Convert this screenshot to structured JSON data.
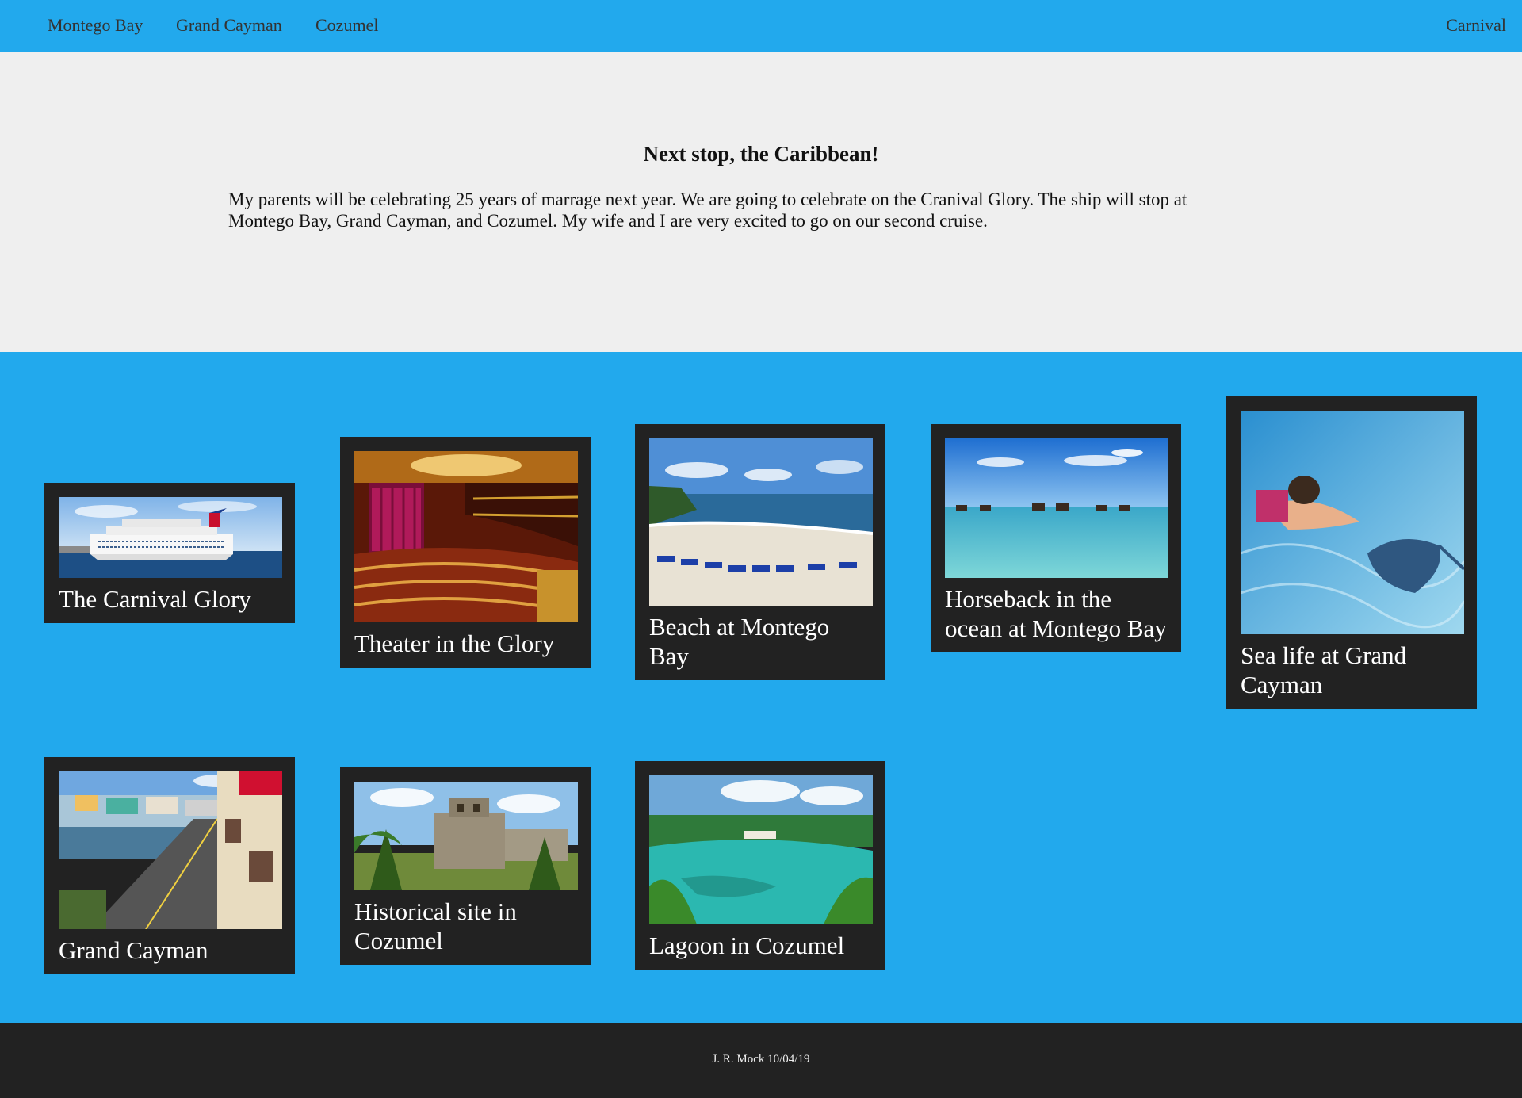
{
  "nav": {
    "links": [
      "Montego Bay",
      "Grand Cayman",
      "Cozumel"
    ],
    "brand": "Carnival"
  },
  "hero": {
    "title": "Next stop, the Caribbean!",
    "body": "My parents will be celebrating 25 years of marrage next year. We are going to celebrate on the Cranival Glory. The ship will stop at Montego Bay, Grand Cayman, and Cozumel. My wife and I are very excited to go on our second cruise."
  },
  "gallery": {
    "cards": [
      {
        "caption": "The Carnival Glory"
      },
      {
        "caption": "Theater in the Glory"
      },
      {
        "caption": "Beach at Montego Bay"
      },
      {
        "caption": "Horseback in the ocean at Montego Bay"
      },
      {
        "caption": "Sea life at Grand Cayman"
      },
      {
        "caption": "Grand Cayman"
      },
      {
        "caption": "Historical site in Cozumel"
      },
      {
        "caption": "Lagoon in Cozumel"
      }
    ]
  },
  "footer": {
    "credit": "J. R. Mock 10/04/19"
  },
  "colors": {
    "accent": "#22a9ed",
    "hero_bg": "#efefef",
    "card_bg": "#222222",
    "footer_bg": "#222222"
  }
}
